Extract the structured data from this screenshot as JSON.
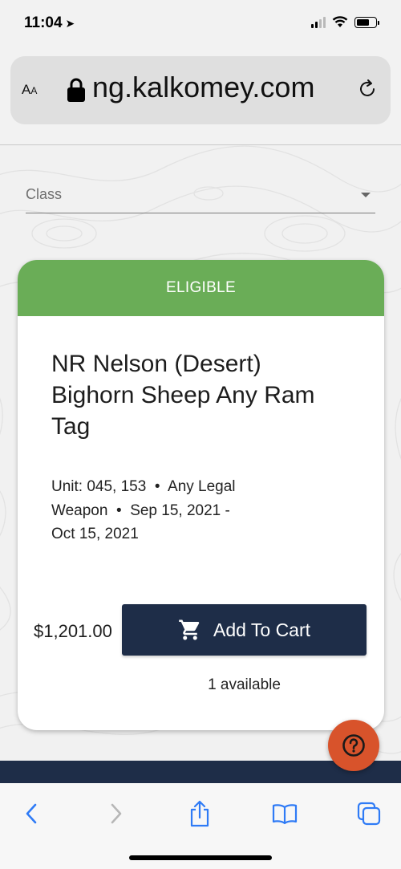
{
  "status_bar": {
    "time": "11:04",
    "location_arrow": "location-arrow-icon"
  },
  "browser": {
    "text_size_label_small": "A",
    "text_size_label_large": "A",
    "url": "ng.kalkomey.com",
    "lock_icon": "lock-icon",
    "reload_icon": "reload-icon"
  },
  "filters": {
    "class_label": "Class"
  },
  "card": {
    "status": "ELIGIBLE",
    "status_color": "#6aad57",
    "title_lines": [
      "NR Nelson (Desert)",
      "Bighorn Sheep Any Ram",
      "Tag"
    ],
    "meta_lines": [
      "Unit: 045, 153  •  Any Legal",
      "Weapon  •  Sep 15, 2021 -",
      "Oct 15, 2021"
    ],
    "price": "$1,201.00",
    "add_to_cart_label": "Add To Cart",
    "availability": "1 available"
  },
  "colors": {
    "navy": "#1e2d48",
    "accent_orange": "#d8532b",
    "safari_blue": "#2f7bf6"
  },
  "safari_toolbar": {
    "items": [
      "back-icon",
      "forward-icon",
      "share-icon",
      "bookmarks-icon",
      "tabs-icon"
    ]
  }
}
